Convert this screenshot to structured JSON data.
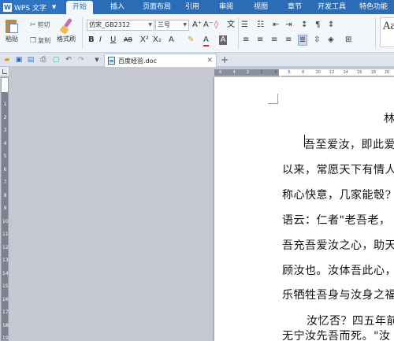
{
  "app": {
    "name": "WPS 文字"
  },
  "tabs": [
    "开始",
    "插入",
    "页面布局",
    "引用",
    "审阅",
    "视图",
    "章节",
    "开发工具",
    "特色功能"
  ],
  "ribbon": {
    "paste": "粘贴",
    "cut": "剪切",
    "copy": "复制",
    "format_painter": "格式刷",
    "font_name": "仿宋_GB2312",
    "font_size": "三号",
    "style_preview": "Aa"
  },
  "document": {
    "tab_title": "百度经验.doc",
    "lines": [
      "林",
      "吾至爱汝，即此爱",
      "以来，常愿天下有情人",
      "称心快意，几家能彀?",
      "语云：仁者\"老吾老，",
      "吾充吾爱汝之心，助天",
      "顾汝也。汝体吾此心，",
      "乐牺牲吾身与汝身之福",
      "汝忆否？四五年前",
      "无宁汝先吾而死。\"汝"
    ]
  },
  "ruler": {
    "horizontal": [
      "6",
      "4",
      "2",
      "2",
      "4",
      "6",
      "8",
      "10",
      "12",
      "14",
      "16",
      "18",
      "20"
    ],
    "vertical": [
      "1",
      "2",
      "3",
      "4",
      "5",
      "6",
      "7",
      "8",
      "9",
      "10",
      "11",
      "12",
      "13",
      "14",
      "15",
      "16",
      "17",
      "18",
      "19"
    ]
  },
  "colors": {
    "accent": "#2b6cb6",
    "ribbon_bg": "#f3f6fb",
    "workspace": "#c5c8d1"
  }
}
